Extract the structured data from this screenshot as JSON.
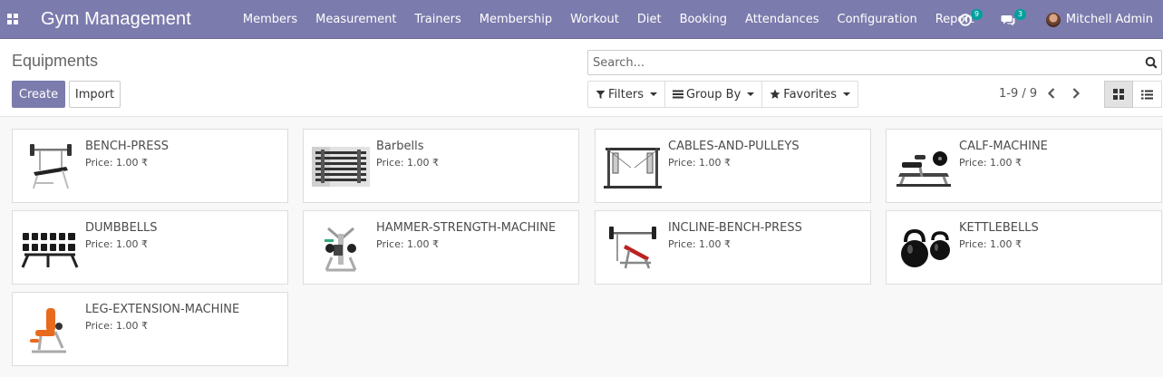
{
  "navbar": {
    "brand": "Gym Management",
    "menu": [
      "Members",
      "Measurement",
      "Trainers",
      "Membership",
      "Workout",
      "Diet",
      "Booking",
      "Attendances",
      "Configuration",
      "Report"
    ],
    "activity_count": "9",
    "message_count": "3",
    "user_name": "Mitchell Admin"
  },
  "control": {
    "title": "Equipments",
    "create_label": "Create",
    "import_label": "Import",
    "search_placeholder": "Search...",
    "filters_label": "Filters",
    "groupby_label": "Group By",
    "favorites_label": "Favorites",
    "pager": "1-9 / 9"
  },
  "equipments": [
    {
      "name": "BENCH-PRESS",
      "price": "Price: 1.00 ₹",
      "image": "bench-press-image"
    },
    {
      "name": "Barbells",
      "price": "Price: 1.00 ₹",
      "image": "barbells-image"
    },
    {
      "name": "CABLES-AND-PULLEYS",
      "price": "Price: 1.00 ₹",
      "image": "cables-and-pulleys-image"
    },
    {
      "name": "CALF-MACHINE",
      "price": "Price: 1.00 ₹",
      "image": "calf-machine-image"
    },
    {
      "name": "DUMBBELLS",
      "price": "Price: 1.00 ₹",
      "image": "dumbbells-image"
    },
    {
      "name": "HAMMER-STRENGTH-MACHINE",
      "price": "Price: 1.00 ₹",
      "image": "hammer-strength-machine-image"
    },
    {
      "name": "INCLINE-BENCH-PRESS",
      "price": "Price: 1.00 ₹",
      "image": "incline-bench-press-image"
    },
    {
      "name": "KETTLEBELLS",
      "price": "Price: 1.00 ₹",
      "image": "kettlebells-image"
    },
    {
      "name": "LEG-EXTENSION-MACHINE",
      "price": "Price: 1.00 ₹",
      "image": "leg-extension-machine-image"
    }
  ],
  "colors": {
    "brand": "#7c7bad",
    "badge": "#00a09d"
  }
}
